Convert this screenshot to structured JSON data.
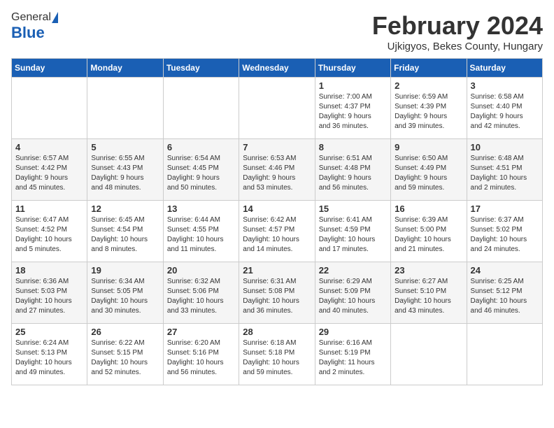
{
  "logo": {
    "general": "General",
    "blue": "Blue"
  },
  "header": {
    "month": "February 2024",
    "location": "Ujkigyos, Bekes County, Hungary"
  },
  "days_of_week": [
    "Sunday",
    "Monday",
    "Tuesday",
    "Wednesday",
    "Thursday",
    "Friday",
    "Saturday"
  ],
  "weeks": [
    [
      {
        "day": "",
        "content": ""
      },
      {
        "day": "",
        "content": ""
      },
      {
        "day": "",
        "content": ""
      },
      {
        "day": "",
        "content": ""
      },
      {
        "day": "1",
        "content": "Sunrise: 7:00 AM\nSunset: 4:37 PM\nDaylight: 9 hours\nand 36 minutes."
      },
      {
        "day": "2",
        "content": "Sunrise: 6:59 AM\nSunset: 4:39 PM\nDaylight: 9 hours\nand 39 minutes."
      },
      {
        "day": "3",
        "content": "Sunrise: 6:58 AM\nSunset: 4:40 PM\nDaylight: 9 hours\nand 42 minutes."
      }
    ],
    [
      {
        "day": "4",
        "content": "Sunrise: 6:57 AM\nSunset: 4:42 PM\nDaylight: 9 hours\nand 45 minutes."
      },
      {
        "day": "5",
        "content": "Sunrise: 6:55 AM\nSunset: 4:43 PM\nDaylight: 9 hours\nand 48 minutes."
      },
      {
        "day": "6",
        "content": "Sunrise: 6:54 AM\nSunset: 4:45 PM\nDaylight: 9 hours\nand 50 minutes."
      },
      {
        "day": "7",
        "content": "Sunrise: 6:53 AM\nSunset: 4:46 PM\nDaylight: 9 hours\nand 53 minutes."
      },
      {
        "day": "8",
        "content": "Sunrise: 6:51 AM\nSunset: 4:48 PM\nDaylight: 9 hours\nand 56 minutes."
      },
      {
        "day": "9",
        "content": "Sunrise: 6:50 AM\nSunset: 4:49 PM\nDaylight: 9 hours\nand 59 minutes."
      },
      {
        "day": "10",
        "content": "Sunrise: 6:48 AM\nSunset: 4:51 PM\nDaylight: 10 hours\nand 2 minutes."
      }
    ],
    [
      {
        "day": "11",
        "content": "Sunrise: 6:47 AM\nSunset: 4:52 PM\nDaylight: 10 hours\nand 5 minutes."
      },
      {
        "day": "12",
        "content": "Sunrise: 6:45 AM\nSunset: 4:54 PM\nDaylight: 10 hours\nand 8 minutes."
      },
      {
        "day": "13",
        "content": "Sunrise: 6:44 AM\nSunset: 4:55 PM\nDaylight: 10 hours\nand 11 minutes."
      },
      {
        "day": "14",
        "content": "Sunrise: 6:42 AM\nSunset: 4:57 PM\nDaylight: 10 hours\nand 14 minutes."
      },
      {
        "day": "15",
        "content": "Sunrise: 6:41 AM\nSunset: 4:59 PM\nDaylight: 10 hours\nand 17 minutes."
      },
      {
        "day": "16",
        "content": "Sunrise: 6:39 AM\nSunset: 5:00 PM\nDaylight: 10 hours\nand 21 minutes."
      },
      {
        "day": "17",
        "content": "Sunrise: 6:37 AM\nSunset: 5:02 PM\nDaylight: 10 hours\nand 24 minutes."
      }
    ],
    [
      {
        "day": "18",
        "content": "Sunrise: 6:36 AM\nSunset: 5:03 PM\nDaylight: 10 hours\nand 27 minutes."
      },
      {
        "day": "19",
        "content": "Sunrise: 6:34 AM\nSunset: 5:05 PM\nDaylight: 10 hours\nand 30 minutes."
      },
      {
        "day": "20",
        "content": "Sunrise: 6:32 AM\nSunset: 5:06 PM\nDaylight: 10 hours\nand 33 minutes."
      },
      {
        "day": "21",
        "content": "Sunrise: 6:31 AM\nSunset: 5:08 PM\nDaylight: 10 hours\nand 36 minutes."
      },
      {
        "day": "22",
        "content": "Sunrise: 6:29 AM\nSunset: 5:09 PM\nDaylight: 10 hours\nand 40 minutes."
      },
      {
        "day": "23",
        "content": "Sunrise: 6:27 AM\nSunset: 5:10 PM\nDaylight: 10 hours\nand 43 minutes."
      },
      {
        "day": "24",
        "content": "Sunrise: 6:25 AM\nSunset: 5:12 PM\nDaylight: 10 hours\nand 46 minutes."
      }
    ],
    [
      {
        "day": "25",
        "content": "Sunrise: 6:24 AM\nSunset: 5:13 PM\nDaylight: 10 hours\nand 49 minutes."
      },
      {
        "day": "26",
        "content": "Sunrise: 6:22 AM\nSunset: 5:15 PM\nDaylight: 10 hours\nand 52 minutes."
      },
      {
        "day": "27",
        "content": "Sunrise: 6:20 AM\nSunset: 5:16 PM\nDaylight: 10 hours\nand 56 minutes."
      },
      {
        "day": "28",
        "content": "Sunrise: 6:18 AM\nSunset: 5:18 PM\nDaylight: 10 hours\nand 59 minutes."
      },
      {
        "day": "29",
        "content": "Sunrise: 6:16 AM\nSunset: 5:19 PM\nDaylight: 11 hours\nand 2 minutes."
      },
      {
        "day": "",
        "content": ""
      },
      {
        "day": "",
        "content": ""
      }
    ]
  ]
}
